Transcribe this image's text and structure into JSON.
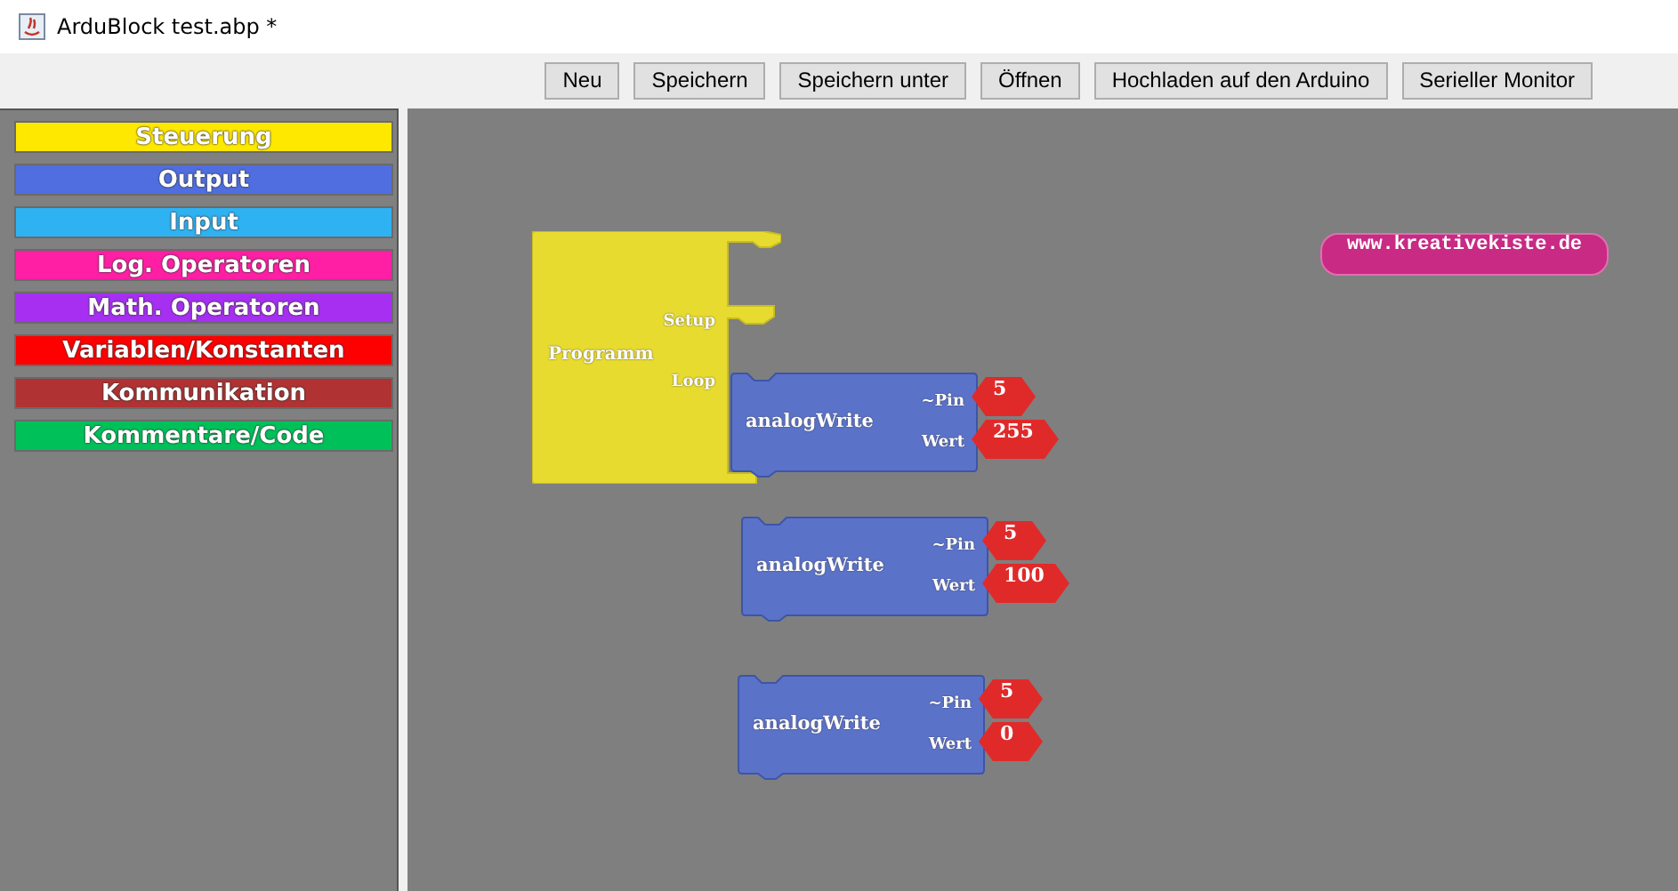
{
  "window": {
    "title": "ArduBlock test.abp *"
  },
  "toolbar": {
    "buttons": [
      "Neu",
      "Speichern",
      "Speichern unter",
      "Öffnen",
      "Hochladen auf den Arduino",
      "Serieller Monitor"
    ]
  },
  "palette": [
    {
      "label": "Steuerung",
      "color": "#ffe800"
    },
    {
      "label": "Output",
      "color": "#506ee0"
    },
    {
      "label": "Input",
      "color": "#2eb2f2"
    },
    {
      "label": "Log. Operatoren",
      "color": "#ff1fa4"
    },
    {
      "label": "Math. Operatoren",
      "color": "#a62ff2"
    },
    {
      "label": "Variablen/Konstanten",
      "color": "#ff0000"
    },
    {
      "label": "Kommunikation",
      "color": "#b03232"
    },
    {
      "label": "Kommentare/Code",
      "color": "#00c05a"
    }
  ],
  "canvas": {
    "program": {
      "title": "Programm",
      "setup_label": "Setup",
      "loop_label": "Loop"
    },
    "blocks": [
      {
        "title": "analogWrite",
        "pin_label": "~Pin",
        "pin": "5",
        "value_label": "Wert",
        "value": "255"
      },
      {
        "title": "analogWrite",
        "pin_label": "~Pin",
        "pin": "5",
        "value_label": "Wert",
        "value": "100"
      },
      {
        "title": "analogWrite",
        "pin_label": "~Pin",
        "pin": "5",
        "value_label": "Wert",
        "value": "0"
      }
    ],
    "link": "www.kreativekiste.de"
  }
}
